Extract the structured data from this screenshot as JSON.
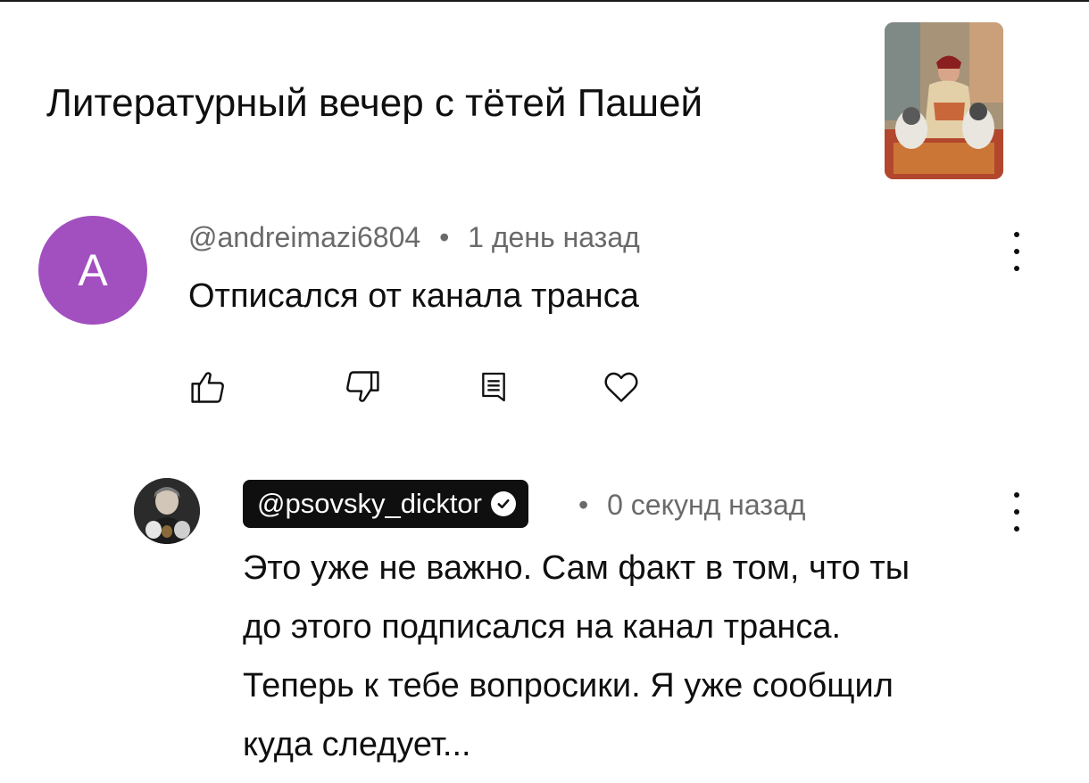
{
  "video": {
    "title": "Литературный вечер с тётей Пашей"
  },
  "comment": {
    "avatar_letter": "A",
    "avatar_color": "#a24fbf",
    "author": "@andreimazi6804",
    "separator": "•",
    "time": "1 день назад",
    "text": "Отписался от канала транса",
    "actions": [
      "like-icon",
      "dislike-icon",
      "reply-icon",
      "heart-icon"
    ]
  },
  "reply": {
    "author": "@psovsky_dicktor",
    "verified": true,
    "separator": "•",
    "time": "0 секунд назад",
    "text_lines": [
      "Это уже не важно. Сам факт в том, что ты",
      "до этого подписался на канал транса.",
      "Теперь к тебе вопросики. Я уже сообщил",
      "куда следует..."
    ]
  }
}
